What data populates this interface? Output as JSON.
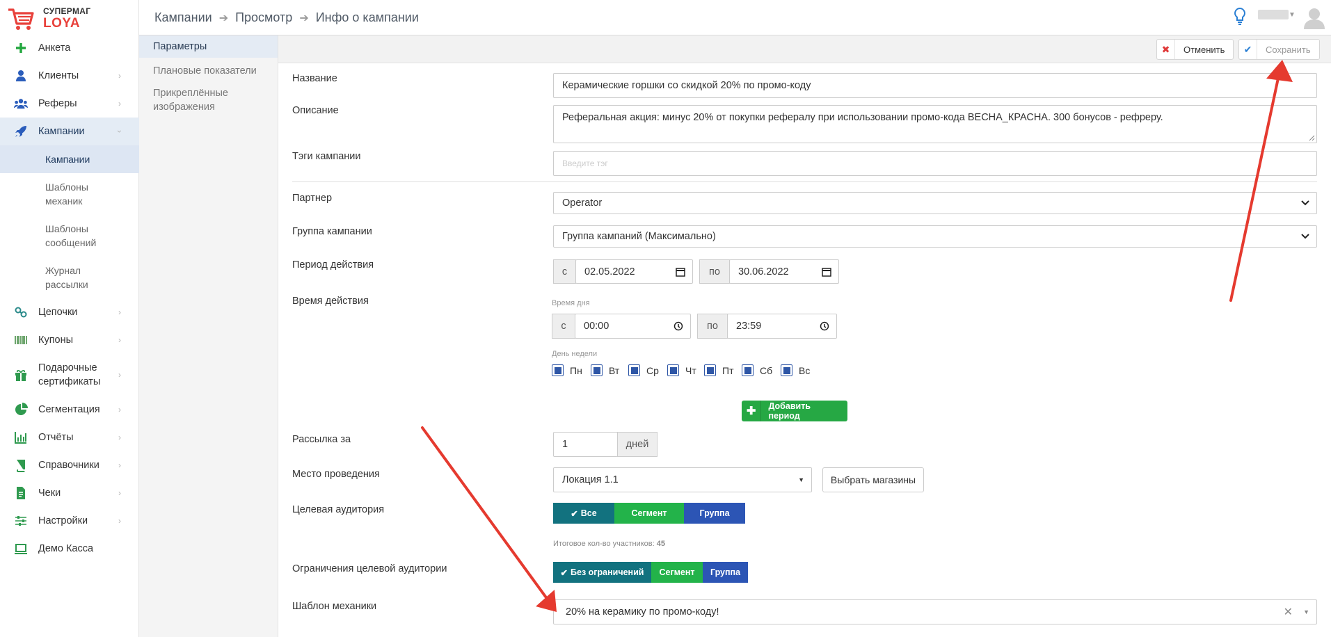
{
  "logo": {
    "line1": "СУПЕРМАГ",
    "line2": "LOYA"
  },
  "sidebar": {
    "items": [
      {
        "label": "Анкета",
        "icon": "plus-icon"
      },
      {
        "label": "Клиенты",
        "icon": "user-icon"
      },
      {
        "label": "Реферы",
        "icon": "users-icon"
      },
      {
        "label": "Кампании",
        "icon": "rocket-icon"
      },
      {
        "label": "Цепочки",
        "icon": "chain-icon"
      },
      {
        "label": "Купоны",
        "icon": "barcode-icon"
      },
      {
        "label": "Подарочные сертификаты",
        "icon": "gift-icon"
      },
      {
        "label": "Сегментация",
        "icon": "pie-icon"
      },
      {
        "label": "Отчёты",
        "icon": "bar-chart-icon"
      },
      {
        "label": "Справочники",
        "icon": "book-icon"
      },
      {
        "label": "Чеки",
        "icon": "receipt-icon"
      },
      {
        "label": "Настройки",
        "icon": "sliders-icon"
      },
      {
        "label": "Демо Касса",
        "icon": "laptop-icon"
      }
    ],
    "campaign_sub": [
      {
        "label": "Кампании"
      },
      {
        "label": "Шаблоны механик"
      },
      {
        "label": "Шаблоны сообщений"
      },
      {
        "label": "Журнал рассылки"
      }
    ]
  },
  "breadcrumb": [
    "Кампании",
    "Просмотр",
    "Инфо о кампании"
  ],
  "subnav": [
    "Параметры",
    "Плановые показатели",
    "Прикреплённые изображения"
  ],
  "toolbar": {
    "cancel_label": "Отменить",
    "save_label": "Сохранить"
  },
  "form": {
    "name_label": "Название",
    "name_value": "Керамические горшки со скидкой 20% по промо-коду",
    "desc_label": "Описание",
    "desc_value": "Реферальная акция: минус 20% от покупки рефералу при использовании промо-кода ВЕСНА_КРАСНА. 300 бонусов - рефреру.",
    "tags_label": "Тэги кампании",
    "tags_placeholder": "Введите тэг",
    "partner_label": "Партнер",
    "partner_value": "Operator",
    "group_label": "Группа кампании",
    "group_value": "Группа кампаний (Максимально)",
    "period_label": "Период действия",
    "period_from_prefix": "с",
    "period_from": "02.05.2022",
    "period_to_prefix": "по",
    "period_to": "30.06.2022",
    "time_label": "Время действия",
    "time_of_day_label": "Время дня",
    "time_from_prefix": "с",
    "time_from": "00:00",
    "time_to_prefix": "по",
    "time_to": "23:59",
    "weekday_label": "День недели",
    "days": [
      "Пн",
      "Вт",
      "Ср",
      "Чт",
      "Пт",
      "Сб",
      "Вс"
    ],
    "add_period_label": "Добавить период",
    "mailing_label": "Рассылка за",
    "mailing_value": "1",
    "mailing_unit": "дней",
    "place_label": "Место проведения",
    "place_value": "Локация 1.1",
    "choose_stores_label": "Выбрать магазины",
    "audience_label": "Целевая аудитория",
    "audience_options": [
      "Все",
      "Сегмент",
      "Группа"
    ],
    "participants_note": "Итоговое кол-во участников:",
    "participants_count": "45",
    "restrict_label": "Ограничения целевой аудитории",
    "restrict_options": [
      "Без ограничений",
      "Сегмент",
      "Группа"
    ],
    "mechanic_label": "Шаблон механики",
    "mechanic_value": "20% на керамику по промо-коду!"
  },
  "colors": {
    "teal": "#12727f",
    "green": "#23b34a",
    "blue": "#2c55b5",
    "arrow": "#e53a2f"
  }
}
